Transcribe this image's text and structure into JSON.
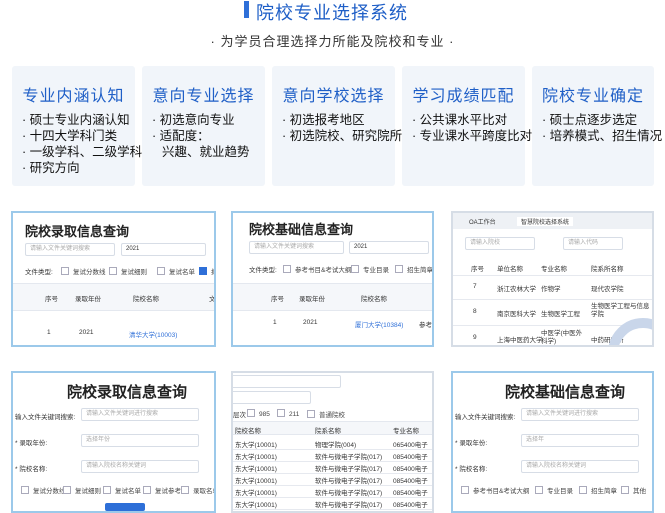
{
  "header": {
    "title": "院校专业选择系统",
    "subtitle": "· 为学员合理选择力所能及院校和专业 ·"
  },
  "cards": [
    {
      "title": "专业内涵认知",
      "items": [
        "· 硕士专业内涵认知",
        "· 十四大学科门类",
        "· 一级学科、二级学科",
        "· 研究方向"
      ]
    },
    {
      "title": "意向专业选择",
      "items": [
        "· 初选意向专业",
        "· 适配度：",
        "兴趣、就业趋势"
      ]
    },
    {
      "title": "意向学校选择",
      "items": [
        "· 初选报考地区",
        "· 初选院校、研究院所"
      ]
    },
    {
      "title": "学习成绩匹配",
      "items": [
        "· 公共课水平比对",
        "· 专业课水平跨度比对"
      ]
    },
    {
      "title": "院校专业确定",
      "items": [
        "· 硕士点逐步选定",
        "· 培养模式、招生情况"
      ]
    }
  ],
  "shot1": {
    "title": "院校录取信息查询",
    "search_placeholder": "请输入文件关键词搜索",
    "year": "2021",
    "filter_label": "文件类型:",
    "filters": [
      "复试分数线",
      "复试细则",
      "复试名单",
      "拟录"
    ],
    "columns": [
      "序号",
      "录取年份",
      "院校名称",
      "文"
    ],
    "row": {
      "index": "1",
      "year": "2021",
      "school": "清华大学(10003)"
    }
  },
  "shot2": {
    "title": "院校基础信息查询",
    "search_placeholder": "请输入文件关键词搜索",
    "year": "2021",
    "filter_label": "文件类型:",
    "filters": [
      "参考书目&考试大纲",
      "专业目录",
      "招生简章"
    ],
    "columns": [
      "序号",
      "录取年份",
      "院校名称"
    ],
    "row": {
      "index": "1",
      "year": "2021",
      "school": "厦门大学(10384)",
      "extra": "参考"
    }
  },
  "shot3": {
    "tabs": [
      "OA工作台",
      "智慧院校选择系统"
    ],
    "search_placeholder": "请输入院校",
    "code_placeholder": "请输入代码",
    "columns": [
      "序号",
      "单位名称",
      "专业名称",
      "院系所名称"
    ],
    "rows": [
      {
        "index": "7",
        "school": "浙江农林大学",
        "major": "作物学",
        "dept": "现代农学院"
      },
      {
        "index": "8",
        "school": "南京医科大学",
        "major": "生物医学工程",
        "dept": "生物医学工程与信息学院"
      },
      {
        "index": "9",
        "school": "上海中医药大学",
        "major": "中医学(中医外科学)",
        "dept": "中药研究所"
      }
    ]
  },
  "shot4": {
    "title": "院校录取信息查询",
    "fields": [
      {
        "label": "输入文件关键词搜索:",
        "placeholder": "请输入文件关键词进行搜索"
      },
      {
        "label": "* 录取年份:",
        "placeholder": "选择年份"
      },
      {
        "label": "* 院校名称:",
        "placeholder": "请输入院校名称关键词"
      }
    ],
    "filters": [
      "复试分数线",
      "复试细则",
      "复试名单",
      "复试参考",
      "录取名单"
    ]
  },
  "shot5": {
    "filter_options": [
      "985",
      "211",
      "普通院校"
    ],
    "filter_prefix": "层次",
    "columns": [
      "院校名称",
      "院系名称",
      "专业名称"
    ],
    "rows": [
      {
        "school": "东大学(10001)",
        "dept": "物理学院(004)",
        "major": "065400电子"
      },
      {
        "school": "东大学(10001)",
        "dept": "软件与微电子学院(017)",
        "major": "085400电子"
      },
      {
        "school": "东大学(10001)",
        "dept": "软件与微电子学院(017)",
        "major": "085400电子"
      },
      {
        "school": "东大学(10001)",
        "dept": "软件与微电子学院(017)",
        "major": "085400电子"
      },
      {
        "school": "东大学(10001)",
        "dept": "软件与微电子学院(017)",
        "major": "085400电子"
      },
      {
        "school": "东大学(10001)",
        "dept": "软件与微电子学院(017)",
        "major": "085400电子"
      }
    ]
  },
  "shot6": {
    "title": "院校基础信息查询",
    "fields": [
      {
        "label": "输入文件关键词搜索:",
        "placeholder": "请输入文件关键词进行搜索"
      },
      {
        "label": "* 录取年份:",
        "placeholder": "选择年"
      },
      {
        "label": "* 院校名称:",
        "placeholder": "请输入院校名称关键词"
      }
    ],
    "filters": [
      "参考书目&考试大纲",
      "专业目录",
      "招生简章",
      "其他"
    ]
  },
  "colors": {
    "accent": "#2e6fd8",
    "title": "#1f5fc7",
    "card_bg": "#f1f5fa",
    "frame": "#9cc9ea"
  }
}
